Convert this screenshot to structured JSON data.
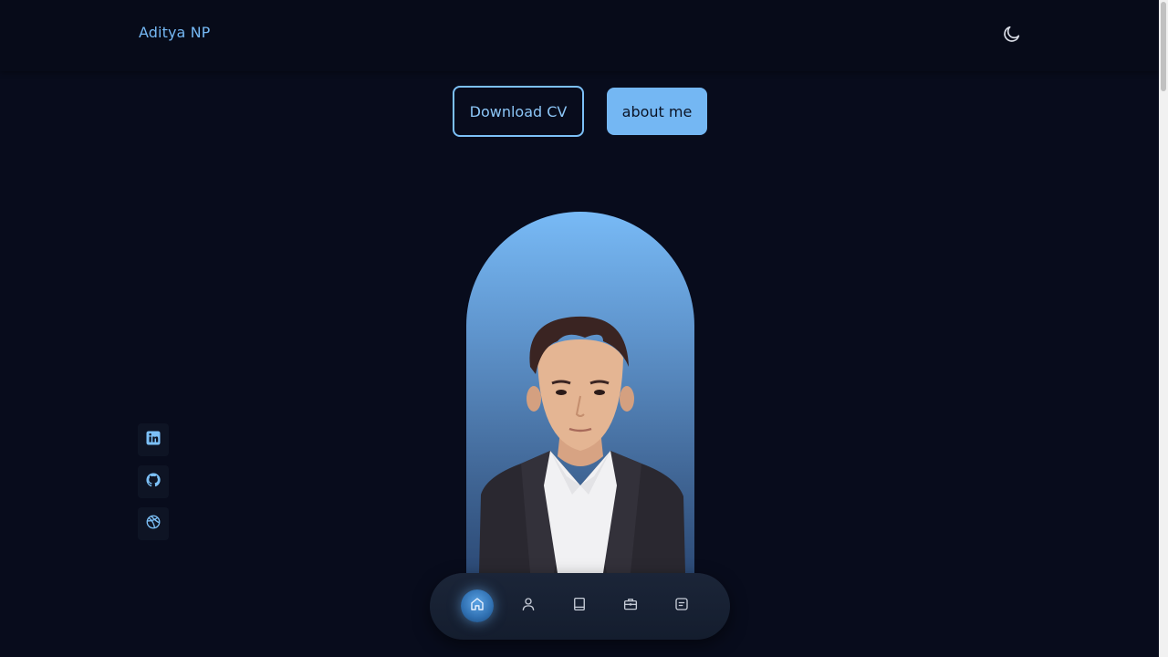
{
  "header": {
    "logo_text": "Aditya NP",
    "theme_toggle_icon": "moon-icon"
  },
  "hero": {
    "download_cv_label": "Download CV",
    "about_me_label": "about me"
  },
  "portrait": {
    "subject": "profile-photo",
    "background_colors": [
      "#78baf6",
      "#2c4a76"
    ]
  },
  "social_links": [
    {
      "icon": "linkedin-icon"
    },
    {
      "icon": "github-icon"
    },
    {
      "icon": "dribbble-icon"
    }
  ],
  "bottom_nav": {
    "items": [
      {
        "icon": "home-icon",
        "active": true
      },
      {
        "icon": "user-icon",
        "active": false
      },
      {
        "icon": "book-icon",
        "active": false
      },
      {
        "icon": "briefcase-icon",
        "active": false
      },
      {
        "icon": "message-icon",
        "active": false
      }
    ]
  },
  "colors": {
    "background": "#080c1c",
    "accent": "#74b7f3"
  }
}
